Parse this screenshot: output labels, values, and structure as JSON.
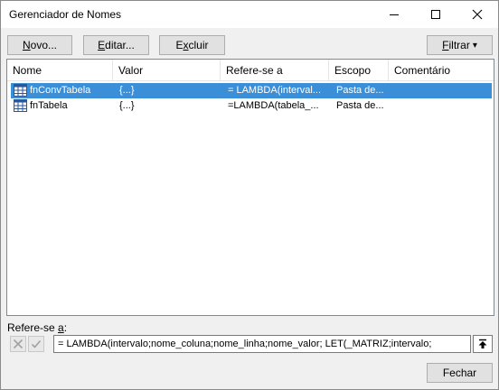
{
  "window": {
    "title": "Gerenciador de Nomes"
  },
  "toolbar": {
    "new_label_pre": "",
    "new_label_hot": "N",
    "new_label_post": "ovo...",
    "edit_label_pre": "",
    "edit_label_hot": "E",
    "edit_label_post": "ditar...",
    "delete_label_pre": "E",
    "delete_label_hot": "x",
    "delete_label_post": "cluir",
    "filter_label_pre": "",
    "filter_label_hot": "F",
    "filter_label_post": "iltrar",
    "filter_arrow": "▾"
  },
  "table": {
    "columns": [
      "Nome",
      "Valor",
      "Refere-se a",
      "Escopo",
      "Comentário"
    ],
    "rows": [
      {
        "name": "fnConvTabela",
        "value": "{...}",
        "refers_to": "= LAMBDA(interval...",
        "scope": "Pasta de...",
        "comment": "",
        "selected": true
      },
      {
        "name": "fnTabela",
        "value": "{...}",
        "refers_to": "=LAMBDA(tabela_...",
        "scope": "Pasta de...",
        "comment": "",
        "selected": false
      }
    ]
  },
  "refers": {
    "label_pre": "Refere-se ",
    "label_hot": "a",
    "label_post": ":",
    "formula": "= LAMBDA(intervalo;nome_coluna;nome_linha;nome_valor;    LET(_MATRIZ;intervalo;"
  },
  "footer": {
    "close_label": "Fechar"
  },
  "colors": {
    "selection": "#3b8fd9",
    "window_bg": "#f0f0f0",
    "button_bg": "#e1e1e1"
  }
}
